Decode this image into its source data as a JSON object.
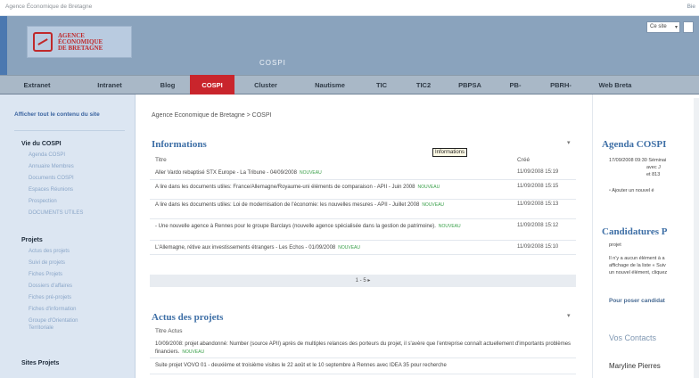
{
  "topbar": {
    "site_name": "Agence Économique de Bretagne",
    "right_text": "Bie"
  },
  "header": {
    "logo": {
      "line1": "AGENCE",
      "line2": "ÉCONOMIQUE",
      "line3": "DE BRETAGNE"
    },
    "subtitle": "COSPI",
    "search_scope": "Ce site"
  },
  "tabs": [
    {
      "label": "Extranet"
    },
    {
      "label": "Intranet"
    },
    {
      "label": "Blog"
    },
    {
      "label": "COSPI",
      "active": true
    },
    {
      "label": "Cluster"
    },
    {
      "label": "Nautisme"
    },
    {
      "label": "TIC"
    },
    {
      "label": "TIC2"
    },
    {
      "label": "PBPSA"
    },
    {
      "label": "PB-"
    },
    {
      "label": "PBRH-"
    },
    {
      "label": "Web Breta"
    }
  ],
  "left_nav": {
    "show_all": "Afficher tout le contenu du site",
    "sections": [
      {
        "title": "Vie du COSPI",
        "items": [
          "Agenda COSPI",
          "Annuaire Membres",
          "Documents COSPI",
          "Espaces Réunions",
          "Prospection",
          "DOCUMENTS UTILES"
        ]
      },
      {
        "title": "Projets",
        "items": [
          "Actus des projets",
          "Suivi de projets",
          "Fiches Projets",
          "Dossiers d'affaires",
          "Fiches pré-projets",
          "Fiches d'information",
          "Groupe d'Orientation",
          "Territoriale"
        ]
      },
      {
        "title": "Sites Projets",
        "items": []
      }
    ]
  },
  "main": {
    "breadcrumb": "Agence Economique de Bretagne > COSPI",
    "informations": {
      "title": "Informations",
      "col_title": "Titre",
      "col_date": "Créé",
      "tooltip": "Informations",
      "rows": [
        {
          "title": "Aller Vardo rebaptisé STX Europe - La Tribune - 04/09/2008",
          "new": "NOUVEAU",
          "date": "11/09/2008 15:19"
        },
        {
          "title": "A lire dans les documents utiles: France/Allemagne/Royaume-uni éléments de comparaison - APII - Juin 2008",
          "new": "NOUVEAU",
          "date": "11/09/2008 15:15"
        },
        {
          "title": "A lire dans les documents utiles: Loi de modernisation de l'économie: les nouvelles mesures - APII - Juillet 2008",
          "new": "NOUVEAU",
          "date": "11/09/2008 15:13"
        },
        {
          "title": "- Une nouvelle agence à Rennes pour le groupe Barclays (nouvelle agence spécialisée dans la gestion de patrimoine).",
          "new": "NOUVEAU",
          "date": "11/09/2008 15:12"
        },
        {
          "title": "L'Allemagne, rétive aux investissements étrangers - Les Echos - 01/09/2008",
          "new": "NOUVEAU",
          "date": "11/09/2008 15:10"
        }
      ],
      "pager": "1 - 5 ▸"
    },
    "actus": {
      "title": "Actus des projets",
      "col_title": "Titre Actus",
      "rows": [
        {
          "title": "10/09/2008: projet abandonné: Number (source APII) après de multiples relances des porteurs du projet, il s'avère que l'entreprise connaît actuellement d'importants problèmes financiers.",
          "new": "NOUVEAU"
        },
        {
          "title": "Suite projet VOVO 01 - deuxième et troisième visites le 22 août et le 10 septembre à Rennes avec IDEA 35 pour recherche",
          "new": ""
        }
      ]
    }
  },
  "right": {
    "agenda": {
      "title": "Agenda COSPI",
      "entry_line1": "17/09/2008 09:30  Séminai",
      "entry_line2": "avec J",
      "entry_line3": "et 813",
      "add": "Ajouter un nouvel é"
    },
    "candidatures": {
      "title": "Candidatures P",
      "col": "projet",
      "empty_line1": "Il n'y a aucun élément à a",
      "empty_line2": "affichage de la liste « Suiv",
      "empty_line3": "un nouvel élément, cliquez",
      "link": "Pour poser candidat"
    },
    "contacts": {
      "title": "Vos Contacts",
      "person": "Maryline Pierres"
    }
  }
}
